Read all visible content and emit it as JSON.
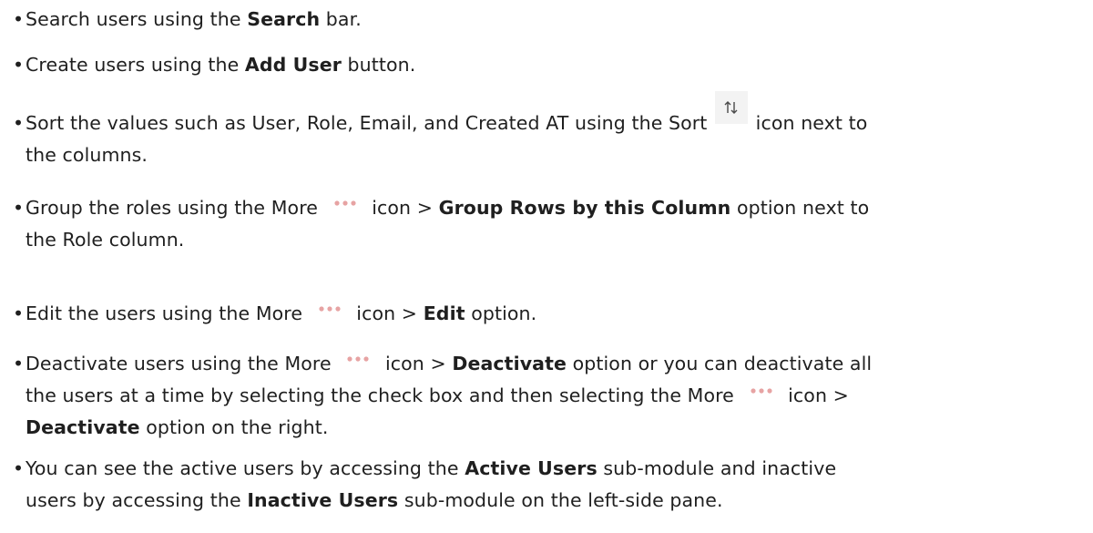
{
  "bullets": [
    {
      "lines": [
        {
          "parts": [
            {
              "t": "Search users using the "
            },
            {
              "b": "Search"
            },
            {
              "t": " bar."
            }
          ]
        }
      ]
    },
    {
      "lines": [
        {
          "parts": [
            {
              "t": "Create users using the "
            },
            {
              "b": "Add User"
            },
            {
              "t": " button."
            }
          ]
        }
      ]
    },
    {
      "lines": [
        {
          "parts": [
            {
              "t": "Sort the values such as User, Role, Email, and Created AT using the Sort "
            },
            {
              "icon": "sort-icon"
            },
            {
              "t": " icon next to"
            }
          ]
        },
        {
          "parts": [
            {
              "t": "the columns."
            }
          ]
        }
      ]
    },
    {
      "lines": [
        {
          "parts": [
            {
              "t": "Group the roles using the More "
            },
            {
              "icon": "more-icon"
            },
            {
              "t": " icon > "
            },
            {
              "b": "Group Rows by this Column"
            },
            {
              "t": " option next to"
            }
          ]
        },
        {
          "parts": [
            {
              "t": "the Role column."
            }
          ]
        }
      ]
    },
    {
      "lines": [
        {
          "parts": [
            {
              "t": "Edit the users using the More "
            },
            {
              "icon": "more-icon"
            },
            {
              "t": " icon > "
            },
            {
              "b": "Edit"
            },
            {
              "t": " option."
            }
          ]
        }
      ]
    },
    {
      "lines": [
        {
          "parts": [
            {
              "t": "Deactivate users using the More "
            },
            {
              "icon": "more-icon"
            },
            {
              "t": " icon > "
            },
            {
              "b": "Deactivate"
            },
            {
              "t": " option or you can deactivate all"
            }
          ]
        },
        {
          "parts": [
            {
              "t": "the users at a time by selecting the check box and then selecting the More "
            },
            {
              "icon": "more-icon"
            },
            {
              "t": " icon >"
            }
          ]
        },
        {
          "parts": [
            {
              "b": "Deactivate"
            },
            {
              "t": " option on the right."
            }
          ]
        }
      ]
    },
    {
      "lines": [
        {
          "parts": [
            {
              "t": "You can see the active users by accessing the "
            },
            {
              "b": "Active Users"
            },
            {
              "t": " sub-module and inactive"
            }
          ]
        },
        {
          "parts": [
            {
              "t": "users by accessing the "
            },
            {
              "b": "Inactive Users"
            },
            {
              "t": " sub-module on the left-side pane."
            }
          ]
        }
      ]
    }
  ],
  "bullet_char": "•",
  "colors": {
    "text": "#1f1f1f",
    "more_icon_dots": "#e7a3a3",
    "sort_icon_bg": "#f3f3f3",
    "sort_icon_arrows": "#4a4a4a"
  }
}
